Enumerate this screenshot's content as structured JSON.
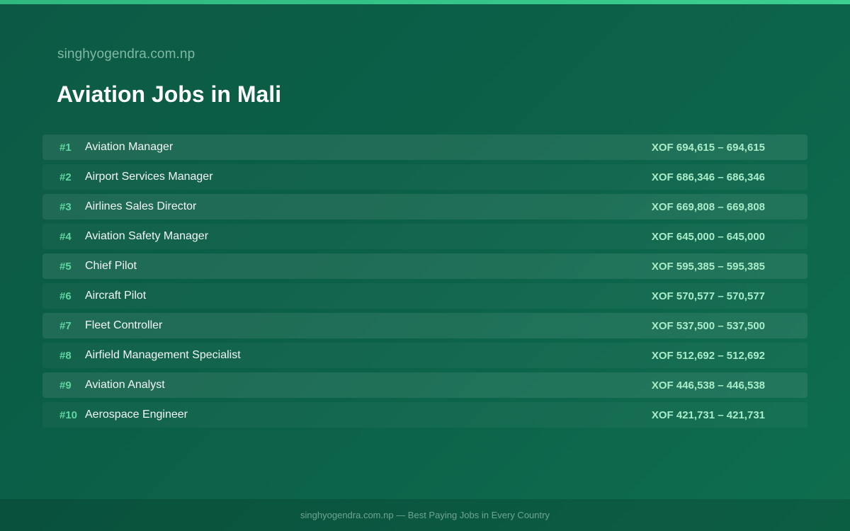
{
  "header": {
    "site_name": "singhyogendra.com.np",
    "title": "Aviation Jobs in Mali"
  },
  "jobs": [
    {
      "rank": "#1",
      "title": "Aviation Manager",
      "salary": "XOF 694,615 – 694,615"
    },
    {
      "rank": "#2",
      "title": "Airport Services Manager",
      "salary": "XOF 686,346 – 686,346"
    },
    {
      "rank": "#3",
      "title": "Airlines Sales Director",
      "salary": "XOF 669,808 – 669,808"
    },
    {
      "rank": "#4",
      "title": "Aviation Safety Manager",
      "salary": "XOF 645,000 – 645,000"
    },
    {
      "rank": "#5",
      "title": "Chief Pilot",
      "salary": "XOF 595,385 – 595,385"
    },
    {
      "rank": "#6",
      "title": "Aircraft Pilot",
      "salary": "XOF 570,577 – 570,577"
    },
    {
      "rank": "#7",
      "title": "Fleet Controller",
      "salary": "XOF 537,500 – 537,500"
    },
    {
      "rank": "#8",
      "title": "Airfield Management Specialist",
      "salary": "XOF 512,692 – 512,692"
    },
    {
      "rank": "#9",
      "title": "Aviation Analyst",
      "salary": "XOF 446,538 – 446,538"
    },
    {
      "rank": "#10",
      "title": "Aerospace Engineer",
      "salary": "XOF 421,731 – 421,731"
    }
  ],
  "footer": {
    "text": "singhyogendra.com.np — Best Paying Jobs in Every Country"
  },
  "colors": {
    "background": "#0b5f47",
    "accent": "#3ccf91",
    "rank": "#5fd6a0",
    "salary": "#a9ecc9"
  }
}
